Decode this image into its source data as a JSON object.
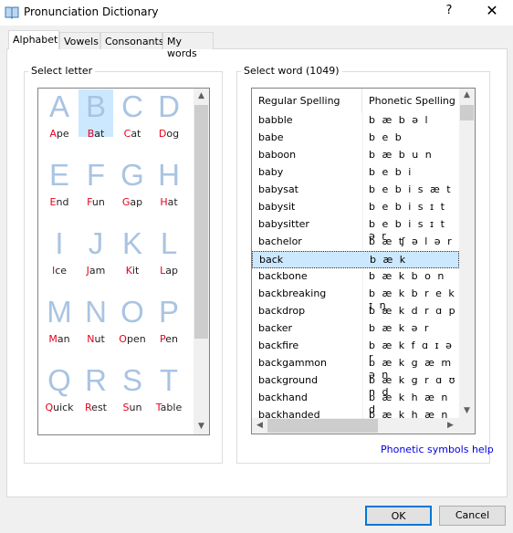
{
  "window": {
    "title": "Pronunciation Dictionary",
    "help": "?",
    "close": "✕",
    "icon": "book-icon"
  },
  "tabs": [
    {
      "label": "Alphabet",
      "active": true
    },
    {
      "label": "Vowels"
    },
    {
      "label": "Consonants"
    },
    {
      "label": "My words"
    }
  ],
  "letter_group": {
    "title": "Select letter",
    "selected": "B",
    "letters": [
      [
        "A",
        "A",
        "pe"
      ],
      [
        "B",
        "B",
        "at"
      ],
      [
        "C",
        "C",
        "at"
      ],
      [
        "D",
        "D",
        "og"
      ],
      [
        "E",
        "E",
        "nd"
      ],
      [
        "F",
        "F",
        "un"
      ],
      [
        "G",
        "G",
        "ap"
      ],
      [
        "H",
        "H",
        "at"
      ],
      [
        "I",
        "I",
        "ce"
      ],
      [
        "J",
        "J",
        "am"
      ],
      [
        "K",
        "K",
        "it"
      ],
      [
        "L",
        "L",
        "ap"
      ],
      [
        "M",
        "M",
        "an"
      ],
      [
        "N",
        "N",
        "ut"
      ],
      [
        "O",
        "O",
        "pen"
      ],
      [
        "P",
        "P",
        "en"
      ],
      [
        "Q",
        "Q",
        "uick"
      ],
      [
        "R",
        "R",
        "est"
      ],
      [
        "S",
        "S",
        "un"
      ],
      [
        "T",
        "T",
        "able"
      ]
    ]
  },
  "word_group": {
    "title": "Select word (1049)",
    "columns": [
      "Regular Spelling",
      "Phonetic Spelling"
    ],
    "selected": "back",
    "rows": [
      [
        "babble",
        "b æ b ə l"
      ],
      [
        "babe",
        "b e b"
      ],
      [
        "baboon",
        "b æ b u n"
      ],
      [
        "baby",
        "b e b i"
      ],
      [
        "babysat",
        "b e b i s æ t"
      ],
      [
        "babysit",
        "b e b i s ɪ t"
      ],
      [
        "babysitter",
        "b e b i s ɪ t ə r"
      ],
      [
        "bachelor",
        "b æ ʧ ə l ə r"
      ],
      [
        "back",
        "b æ k"
      ],
      [
        "backbone",
        "b æ k b o n"
      ],
      [
        "backbreaking",
        "b æ k b r e k ɪ ŋ"
      ],
      [
        "backdrop",
        "b æ k d r ɑ p"
      ],
      [
        "backer",
        "b æ k ə r"
      ],
      [
        "backfire",
        "b æ k f ɑ ɪ ə r"
      ],
      [
        "backgammon",
        "b æ k g æ m ə n"
      ],
      [
        "background",
        "b æ k g r ɑ ʊ n d"
      ],
      [
        "backhand",
        "b æ k h æ n d"
      ],
      [
        "backhanded",
        "b æ k h æ n d ɪ d"
      ]
    ]
  },
  "help_link": "Phonetic symbols help",
  "buttons": {
    "ok": "OK",
    "cancel": "Cancel"
  },
  "colors": {
    "accent": "#0078d7",
    "selection": "#cce8ff",
    "letter": "#a9c4e2",
    "initial": "#e8001c",
    "link": "#0000e0"
  }
}
